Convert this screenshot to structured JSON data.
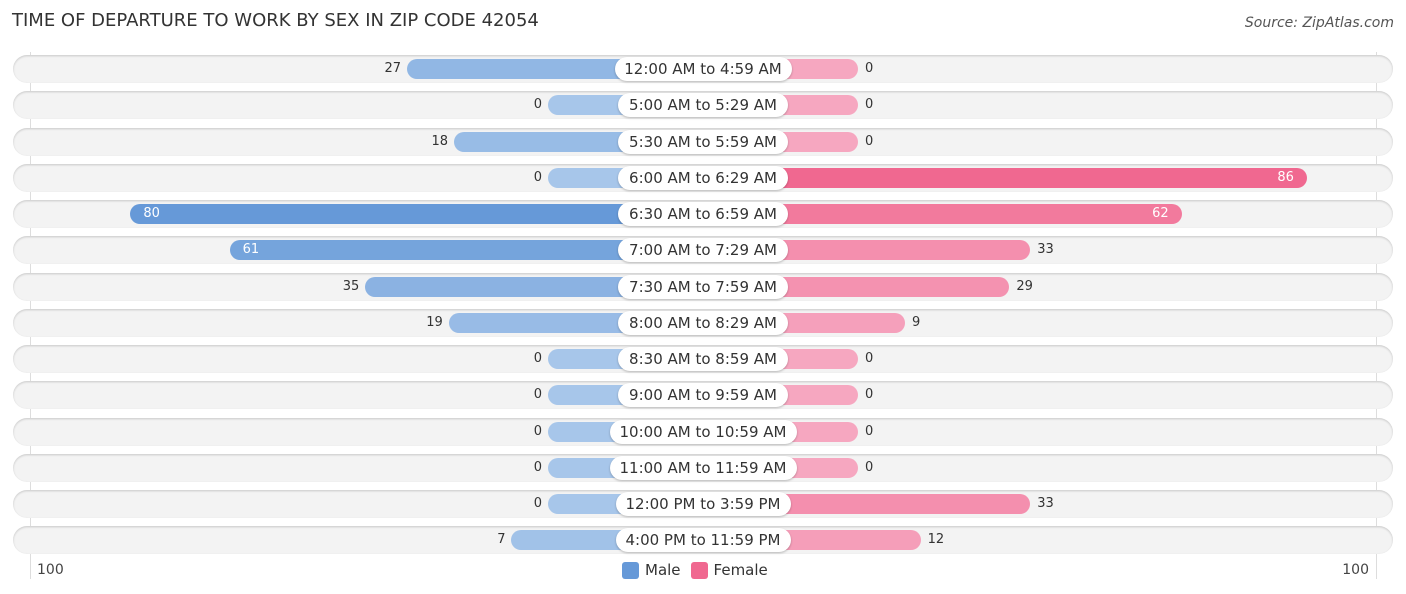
{
  "title": "TIME OF DEPARTURE TO WORK BY SEX IN ZIP CODE 42054",
  "source": "Source: ZipAtlas.com",
  "colors": {
    "male_strong": "#6699d8",
    "male_light": "#a7c6ea",
    "female_strong": "#f06890",
    "female_light": "#f6a7c0"
  },
  "chart_data": {
    "type": "bar",
    "orientation": "horizontal-diverging",
    "title": "TIME OF DEPARTURE TO WORK BY SEX IN ZIP CODE 42054",
    "categories": [
      "12:00 AM to 4:59 AM",
      "5:00 AM to 5:29 AM",
      "5:30 AM to 5:59 AM",
      "6:00 AM to 6:29 AM",
      "6:30 AM to 6:59 AM",
      "7:00 AM to 7:29 AM",
      "7:30 AM to 7:59 AM",
      "8:00 AM to 8:29 AM",
      "8:30 AM to 8:59 AM",
      "9:00 AM to 9:59 AM",
      "10:00 AM to 10:59 AM",
      "11:00 AM to 11:59 AM",
      "12:00 PM to 3:59 PM",
      "4:00 PM to 11:59 PM"
    ],
    "series": [
      {
        "name": "Male",
        "values": [
          27,
          0,
          18,
          0,
          80,
          61,
          35,
          19,
          0,
          0,
          0,
          0,
          0,
          7
        ]
      },
      {
        "name": "Female",
        "values": [
          0,
          0,
          0,
          86,
          62,
          33,
          29,
          9,
          0,
          0,
          0,
          0,
          33,
          12
        ]
      }
    ],
    "axis": {
      "left_label": "100",
      "right_label": "100",
      "max": 100
    },
    "legend": {
      "position": "bottom-center",
      "entries": [
        "Male",
        "Female"
      ]
    }
  }
}
